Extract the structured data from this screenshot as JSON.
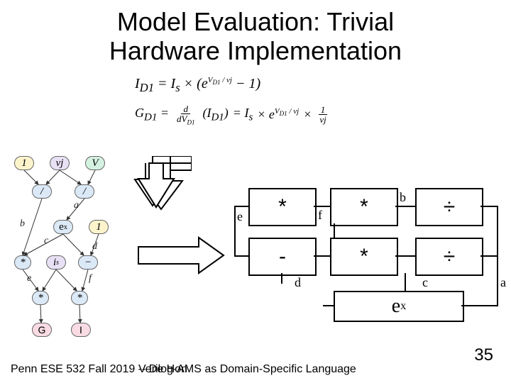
{
  "title": "Model Evaluation: Trivial\nHardware Implementation",
  "equations": {
    "eq1_lhs": "I",
    "eq1_lhs_sub": "D1",
    "eq1_rhs_a": " = I",
    "eq1_rhs_a_sub": "s",
    "eq1_rhs_b": " × (e",
    "eq1_exp1_num": "V",
    "eq1_exp1_sub": "D1",
    "eq1_exp1_slash": " / vj",
    "eq1_tail": " − 1)",
    "eq2_lhs": "G",
    "eq2_lhs_sub": "D1",
    "eq2_frac1_num": "d",
    "eq2_frac1_den": "dV",
    "eq2_frac1_den_sub": "D1",
    "eq2_paren_inner": "I",
    "eq2_paren_inner_sub": "D1",
    "eq2_mid": " = I",
    "eq2_mid_sub": "s",
    "eq2_mid2": " × e",
    "eq2_exp_num": "V",
    "eq2_exp_sub": "D1",
    "eq2_exp_slash": " / vj",
    "eq2_times": " ×",
    "eq2_frac2_num": "1",
    "eq2_frac2_den": "vj"
  },
  "graph": {
    "n_one": "1",
    "n_vj": "vj",
    "n_V": "V",
    "n_div1": "/",
    "n_div2": "/",
    "n_exp": "e^x",
    "n_is": "i_s",
    "n_const1": "1",
    "n_mul1": "*",
    "n_sub": "−",
    "n_mul2": "*",
    "n_mul3": "*",
    "n_G": "G",
    "n_I": "I",
    "lbl_a": "a",
    "lbl_b": "b",
    "lbl_c": "c",
    "lbl_d": "d",
    "lbl_e": "e",
    "lbl_f": "f"
  },
  "hw": {
    "mul": "*",
    "sub": "-",
    "div": "÷",
    "exp": "eˣ",
    "port_a": "a",
    "port_b": "b",
    "port_c": "c",
    "port_d": "d",
    "port_e": "e",
    "port_f": "f"
  },
  "footer": {
    "left": "Penn ESE 532 Fall 2019 -- De Hon",
    "mid": "Verilog-AMS as Domain-Specific Language"
  },
  "page_number": "35"
}
